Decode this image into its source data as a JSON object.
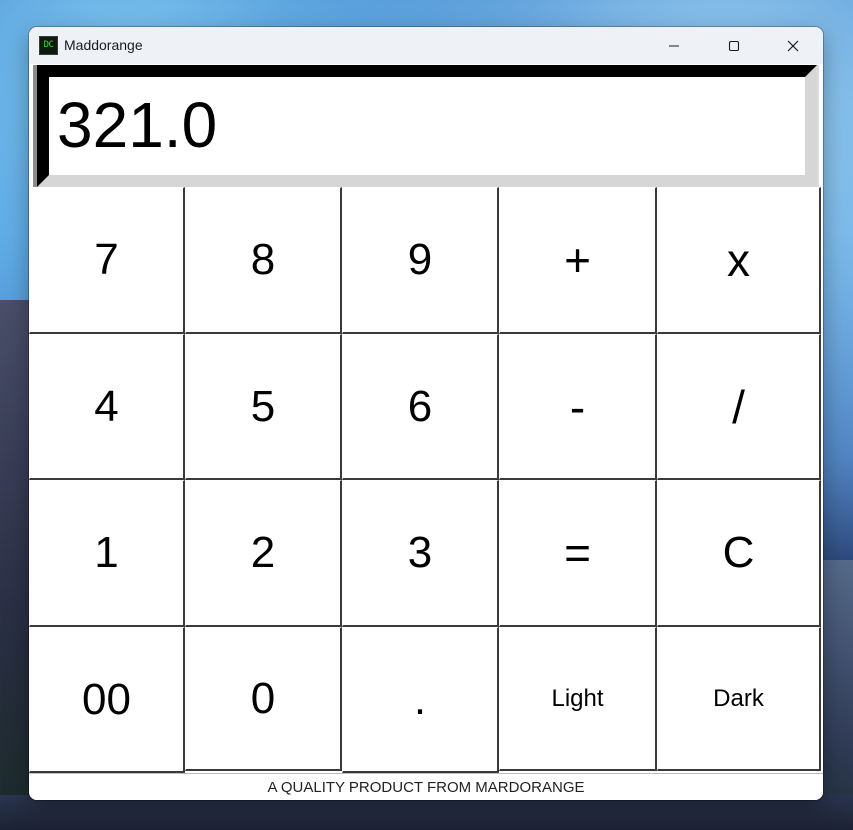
{
  "window": {
    "title": "Maddorange",
    "icon_text": "DC",
    "controls": {
      "minimize_icon": "minimize-icon",
      "maximize_icon": "maximize-icon",
      "close_icon": "close-icon"
    }
  },
  "display": {
    "value": "321.0"
  },
  "keypad": {
    "rows": [
      [
        "7",
        "8",
        "9",
        "+",
        "x"
      ],
      [
        "4",
        "5",
        "6",
        "-",
        "/"
      ],
      [
        "1",
        "2",
        "3",
        "=",
        "C"
      ],
      [
        "00",
        "0",
        ".",
        "Light",
        "Dark"
      ]
    ]
  },
  "footer": {
    "text": "A QUALITY PRODUCT FROM MARDORANGE"
  },
  "colors": {
    "titlebar": "#eef2f7",
    "key_face": "#ffffff",
    "key_shadow": "#3a3a3a",
    "display_border_dark": "#000000",
    "display_border_light": "#d6d6d6",
    "icon_text": "#2ee02e"
  }
}
